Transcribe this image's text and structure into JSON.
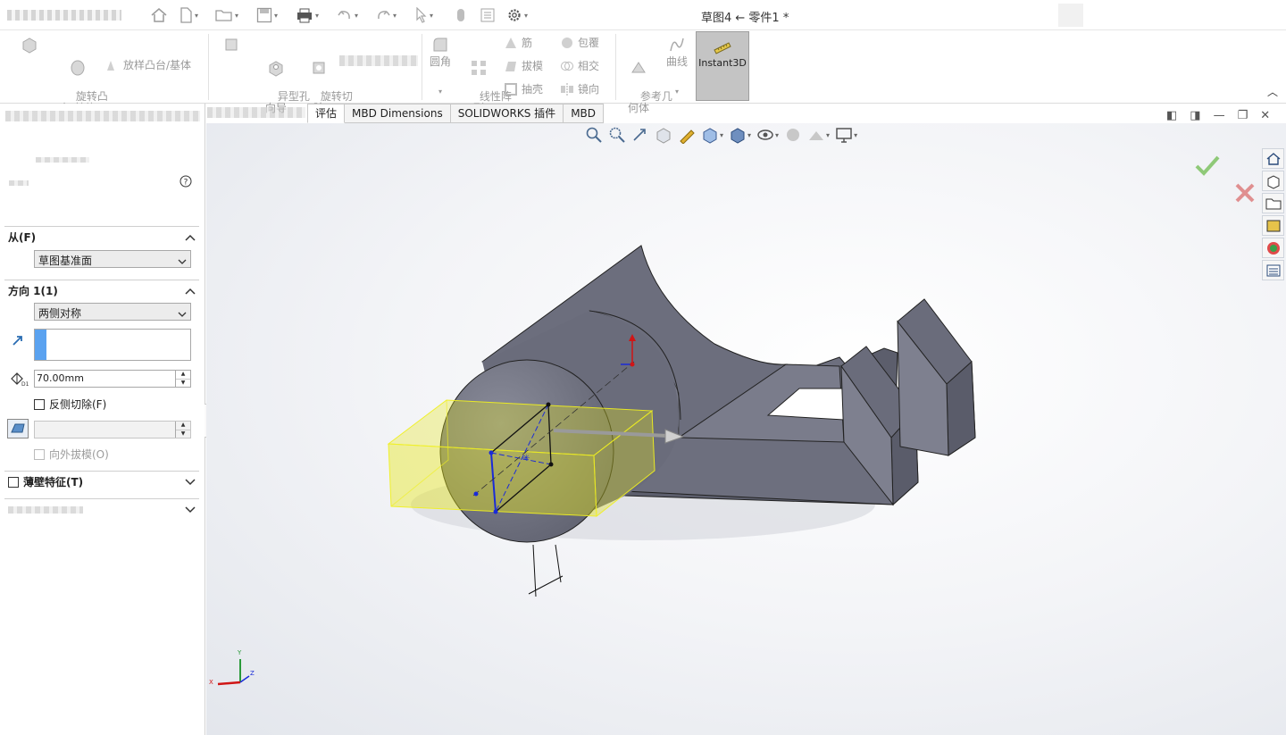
{
  "window": {
    "title": "草图4 ← 零件1 *"
  },
  "quick_access": {
    "icons": [
      "home-icon",
      "new-file-icon",
      "open-folder-icon",
      "save-icon",
      "print-icon",
      "undo-icon",
      "redo-icon",
      "select-arrow-icon",
      "rebuild-icon",
      "file-properties-icon",
      "options-gear-icon"
    ]
  },
  "ribbon": {
    "revolve_boss": "旋转凸\n台/基体",
    "loft_boss": "放样凸台/基体",
    "hole_wizard": "异型孔\n向导",
    "revolve_cut": "旋转切\n除",
    "fillet": "圆角",
    "linear_pattern": "线性阵\n列",
    "rib": "筋",
    "draft": "拔模",
    "shell": "抽壳",
    "wrap": "包覆",
    "intersect": "相交",
    "mirror": "镜向",
    "ref_geometry": "参考几\n何体",
    "curves": "曲线",
    "instant3d": "Instant3D"
  },
  "tabs": [
    {
      "label": "评估"
    },
    {
      "label": "MBD Dimensions"
    },
    {
      "label": "SOLIDWORKS 插件"
    },
    {
      "label": "MBD"
    }
  ],
  "property_manager": {
    "help_icon": "help-icon",
    "from": {
      "header": "从(F)",
      "start_condition": "草图基准面"
    },
    "direction1": {
      "header": "方向 1(1)",
      "end_condition": "两侧对称",
      "direction_value": "",
      "depth": "70.00mm",
      "flip_side_label": "反侧切除(F)",
      "draft_value": "",
      "draft_outward_label": "向外拔模(O)"
    },
    "thin_feature": {
      "header": "薄壁特征(T)"
    }
  },
  "viewport": {
    "ok_color": "#6dbb4e",
    "cancel_color": "#d96d6d",
    "sketch_color": "#e6e619",
    "body_color": "#6f7180"
  }
}
